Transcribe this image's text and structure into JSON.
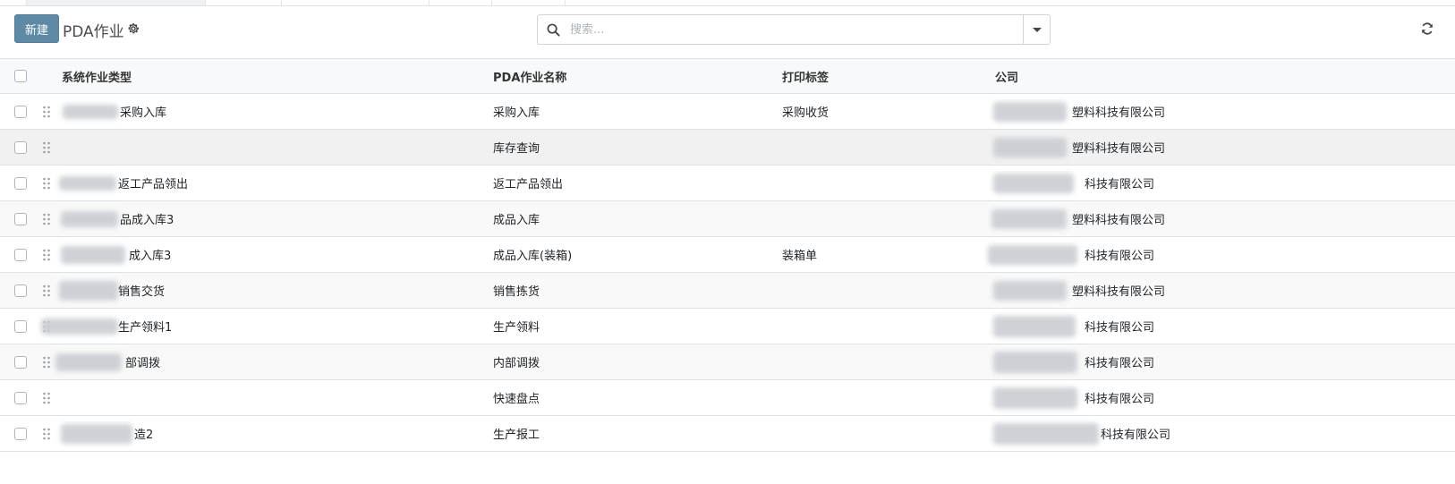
{
  "toolbar": {
    "new_label": "新建",
    "title": "PDA作业"
  },
  "search": {
    "placeholder": "搜索..."
  },
  "table": {
    "columns": [
      "系统作业类型",
      "PDA作业名称",
      "打印标签",
      "公司"
    ],
    "rows": [
      {
        "type": "采购入库",
        "name": "采购入库",
        "label": "采购收货",
        "company": "塑料科技有限公司"
      },
      {
        "type": "",
        "name": "库存查询",
        "label": "",
        "company": "塑料科技有限公司"
      },
      {
        "type": "返工产品领出",
        "name": "返工产品领出",
        "label": "",
        "company": "科技有限公司"
      },
      {
        "type": "品成入库3",
        "name": "成品入库",
        "label": "",
        "company": "塑料科技有限公司"
      },
      {
        "type": "成入库3",
        "name": "成品入库(装箱)",
        "label": "装箱单",
        "company": "科技有限公司"
      },
      {
        "type": "销售交货",
        "name": "销售拣货",
        "label": "",
        "company": "塑料科技有限公司"
      },
      {
        "type": "生产领料1",
        "name": "生产领料",
        "label": "",
        "company": "科技有限公司"
      },
      {
        "type": "部调拨",
        "name": "内部调拨",
        "label": "",
        "company": "科技有限公司"
      },
      {
        "type": "",
        "name": "快速盘点",
        "label": "",
        "company": "科技有限公司"
      },
      {
        "type": "造2",
        "name": "生产报工",
        "label": "",
        "company": "科技有限公司"
      }
    ]
  },
  "colors": {
    "primary": "#5e8aa6",
    "border": "#dee2e6",
    "header_bg": "#f8f9fa"
  },
  "icons": [
    "gear-icon",
    "search-icon",
    "chevron-down-icon",
    "refresh-icon",
    "drag-handle-icon"
  ]
}
